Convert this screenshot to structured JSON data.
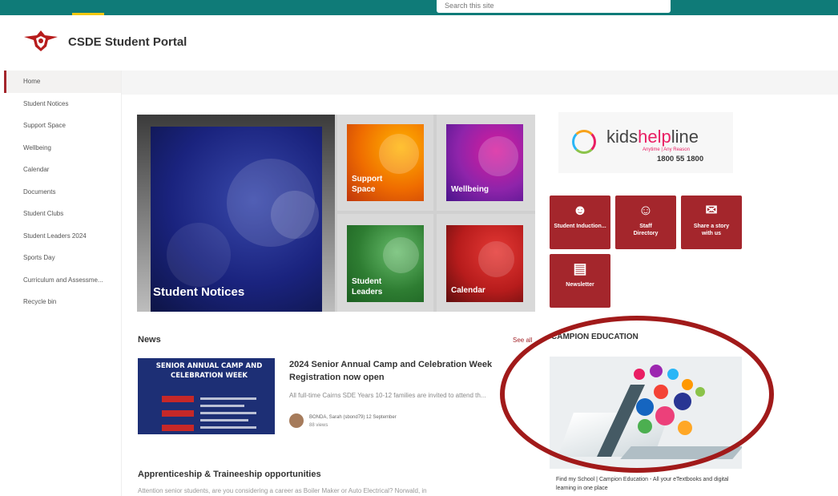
{
  "topbar": {
    "search_placeholder": "Search this site"
  },
  "site": {
    "title": "CSDE Student Portal"
  },
  "nav": {
    "items": [
      {
        "label": "Home"
      },
      {
        "label": "Student Notices"
      },
      {
        "label": "Support Space"
      },
      {
        "label": "Wellbeing"
      },
      {
        "label": "Calendar"
      },
      {
        "label": "Documents"
      },
      {
        "label": "Student Clubs"
      },
      {
        "label": "Student Leaders 2024"
      },
      {
        "label": "Sports Day"
      },
      {
        "label": "Curriculum and Assessme..."
      },
      {
        "label": "Recycle bin"
      }
    ]
  },
  "tiles": {
    "notices": {
      "label": "Student Notices"
    },
    "support": {
      "label": "Support Space"
    },
    "wellbeing": {
      "label": "Wellbeing"
    },
    "leaders": {
      "label": "Student Leaders"
    },
    "calendar": {
      "label": "Calendar"
    }
  },
  "kidshelpline": {
    "kids": "kids",
    "help": "help",
    "line": "line",
    "tagline": "Anytime | Any Reason",
    "phone": "1800 55 1800"
  },
  "quicklinks": {
    "induction": "Student Induction...",
    "staff": "Staff Directory",
    "story": "Share a story with us",
    "newsletter": "Newsletter"
  },
  "news": {
    "title": "News",
    "see_all": "See all",
    "poster_line1": "SENIOR ANNUAL CAMP AND",
    "poster_line2": "CELEBRATION WEEK",
    "headline": "2024 Senior Annual Camp and Celebration Week Registration now open",
    "description": "All full-time Cairns SDE Years 10-12 families are invited to attend th...",
    "author": "BONDA, Sarah (sbond79)  12 September",
    "views": "88 views"
  },
  "apprenticeship": {
    "title": "Apprenticeship & Traineeship opportunities",
    "description": "Attention senior students, are you considering a career as Boiler Maker or Auto Electrical? Norwald, in"
  },
  "campion": {
    "title": "CAMPION EDUCATION",
    "caption": "Find my School | Campion Education - All your eTextbooks and digital learning in one place"
  },
  "colors": {
    "accent": "#a4262c",
    "topbar": "#0f7b78",
    "annotation": "#a11a1a"
  }
}
